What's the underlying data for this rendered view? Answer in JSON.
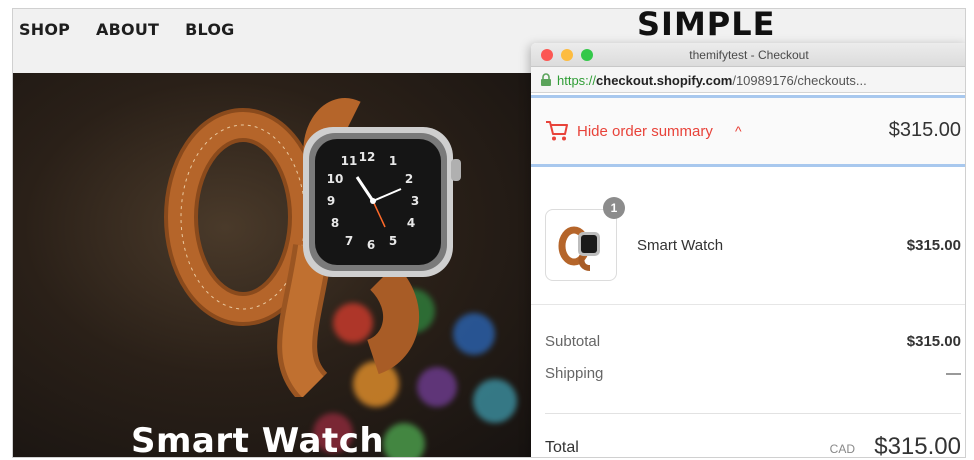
{
  "store": {
    "nav": [
      "SHOP",
      "ABOUT",
      "BLOG"
    ],
    "brand": "SIMPLE",
    "hero_title": "Smart Watch"
  },
  "browser": {
    "window_title": "themifytest - Checkout",
    "url": {
      "scheme": "https://",
      "host": "checkout.shopify.com",
      "path": "/10989176/checkouts..."
    }
  },
  "checkout": {
    "summary_toggle_label": "Hide order summary",
    "summary_toggle_caret": "^",
    "summary_total": "$315.00",
    "product": {
      "quantity": "1",
      "name": "Smart Watch",
      "price": "$315.00"
    },
    "subtotal_label": "Subtotal",
    "subtotal_value": "$315.00",
    "shipping_label": "Shipping",
    "shipping_value": "—",
    "total_label": "Total",
    "currency": "CAD",
    "total_value": "$315.00"
  },
  "colors": {
    "accent_red": "#e8433a",
    "link_green": "#2f9d35",
    "divider_blue": "#a8c8ee"
  },
  "icons": [
    "lock-icon",
    "cart-icon",
    "watch-thumbnail"
  ]
}
